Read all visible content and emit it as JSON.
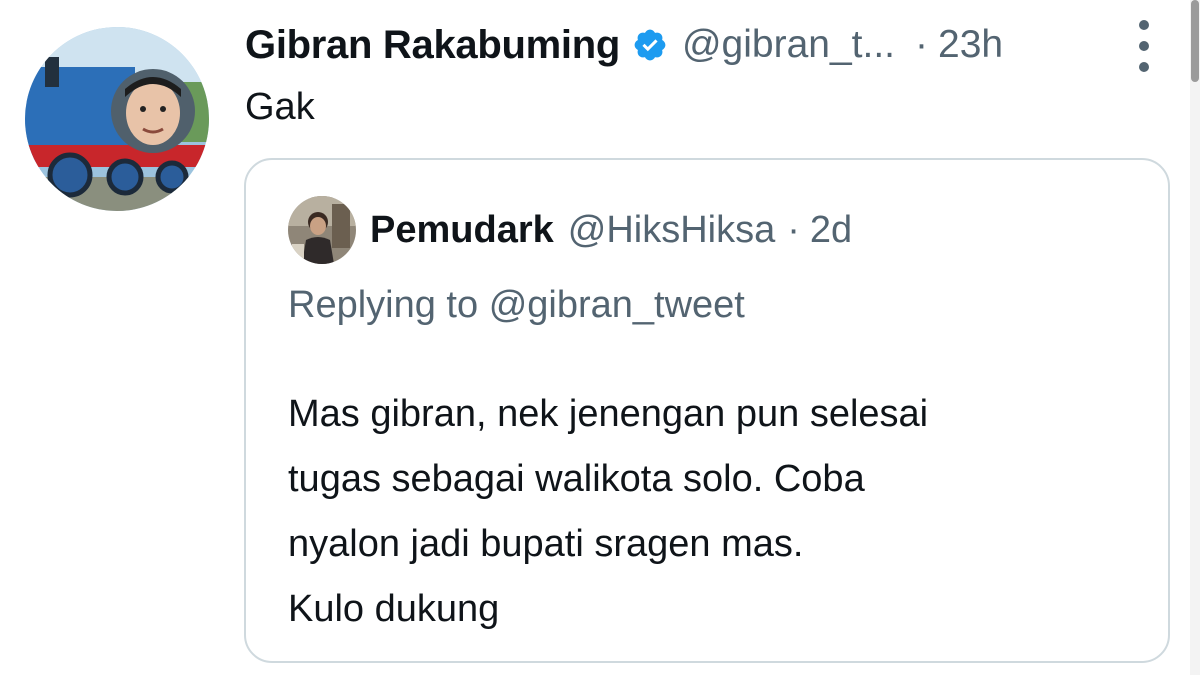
{
  "tweet": {
    "author_name": "Gibran Rakabuming",
    "author_handle": "@gibran_t...",
    "separator": "·",
    "time": "23h",
    "text": "Gak",
    "verified_icon": "verified-badge-icon",
    "more_icon": "more-vertical-icon"
  },
  "quote": {
    "author_name": "Pemudark",
    "author_handle": "@HiksHiksa",
    "separator": "·",
    "time": "2d",
    "replying_prefix": "Replying to",
    "replying_handle": "@gibran_tweet",
    "lines": [
      "Mas gibran, nek jenengan pun selesai",
      "tugas sebagai walikota solo. Coba",
      "nyalon jadi bupati sragen mas.",
      "Kulo dukung"
    ]
  },
  "colors": {
    "text_primary": "#0f1419",
    "text_secondary": "#536471",
    "verified_blue": "#1d9bf0",
    "card_border": "#cfd9de"
  }
}
